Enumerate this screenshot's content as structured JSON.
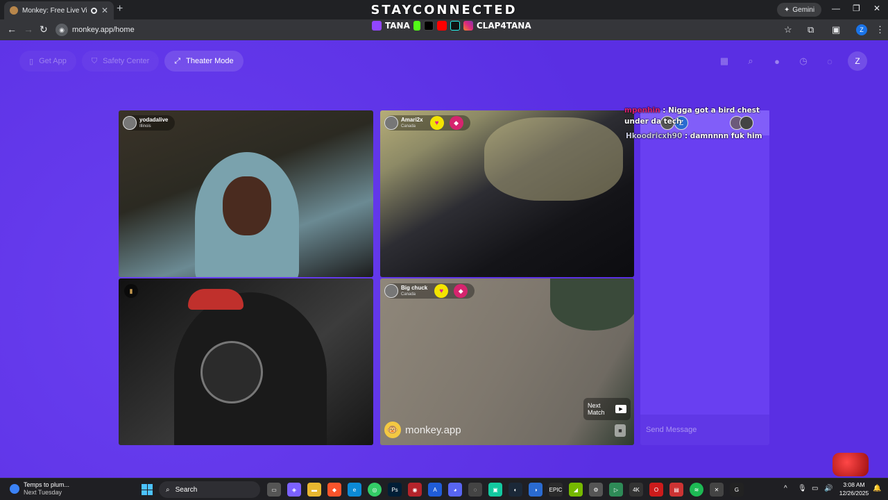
{
  "browser": {
    "tab_title": "Monkey: Free Live Video Cl",
    "new_tab_icon": "+",
    "gemini_label": "Gemini",
    "url": "monkey.app/home",
    "profile_initial": "Z"
  },
  "overlay": {
    "title": "STAYCONNECTED",
    "handle_left": "TANA",
    "handle_right": "CLAP4TANA"
  },
  "nav": {
    "get_app": "Get App",
    "safety_center": "Safety Center",
    "theater_mode": "Theater Mode",
    "user_initial": "Z"
  },
  "tiles": {
    "tile1": {
      "name": "yodadalive",
      "location": "Illinois"
    },
    "tile2": {
      "name": "Amari2x",
      "location": "Canada"
    },
    "tile4": {
      "name": "Big chuck",
      "location": "Canada"
    }
  },
  "controls": {
    "next_match": "Next Match",
    "brand": "monkey.app"
  },
  "chat": {
    "messages": [
      {
        "user": "mpenhin",
        "text": " : Nigga got a bird chest under da tech"
      },
      {
        "user": "Hkoodricxh90",
        "text": " : damnnnn fuk him"
      }
    ],
    "avatar_initial": "Z",
    "send_placeholder": "Send Message"
  },
  "taskbar": {
    "weather_title": "Temps to plum...",
    "weather_sub": "Next Tuesday",
    "search_label": "Search",
    "time": "3:08 AM",
    "date": "12/26/2025"
  },
  "colors": {
    "page_bg": "#5a2fe3",
    "heart_bg": "#f3e400",
    "chat_user1": "#e0216e"
  }
}
